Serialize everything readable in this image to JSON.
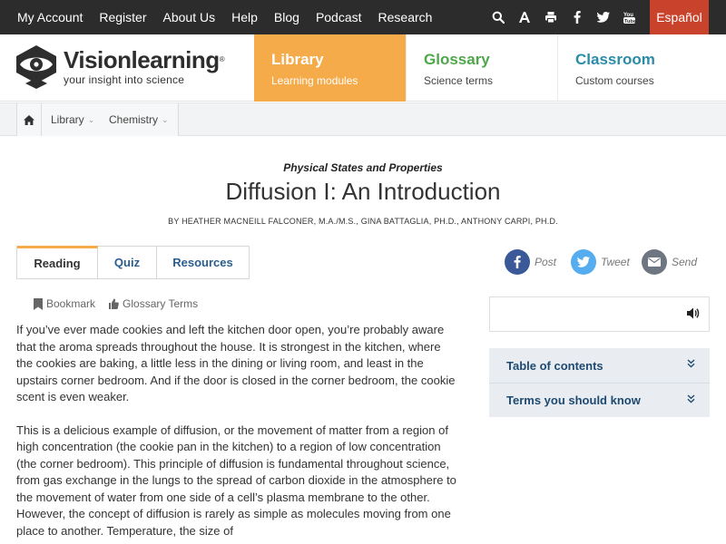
{
  "topnav": {
    "links": [
      "My Account",
      "Register",
      "About Us",
      "Help",
      "Blog",
      "Podcast",
      "Research"
    ],
    "icons": [
      "search-icon",
      "font-size-icon",
      "print-icon",
      "facebook-icon",
      "twitter-icon",
      "youtube-icon"
    ],
    "language": "Español"
  },
  "brand": {
    "name": "Visionlearning",
    "registered": "®",
    "tagline": "your insight into science"
  },
  "header_tabs": [
    {
      "title": "Library",
      "subtitle": "Learning modules",
      "color": "#f5ab4a"
    },
    {
      "title": "Glossary",
      "subtitle": "Science terms",
      "color": "#4fa64b"
    },
    {
      "title": "Classroom",
      "subtitle": "Custom courses",
      "color": "#2a8ca8"
    }
  ],
  "breadcrumb": {
    "home_icon": "home-icon",
    "items": [
      "Library",
      "Chemistry"
    ]
  },
  "article": {
    "kicker": "Physical States and Properties",
    "title": "Diffusion I: An Introduction",
    "authors": "BY HEATHER MACNEILL FALCONER, M.A./M.S., GINA BATTAGLIA, PH.D., ANTHONY CARPI, PH.D.",
    "tabs": [
      "Reading",
      "Quiz",
      "Resources"
    ],
    "tools": {
      "bookmark": "Bookmark",
      "glossary": "Glossary Terms"
    },
    "paragraphs": [
      "If you’ve ever made cookies and left the kitchen door open, you’re probably aware that the aroma spreads throughout the house. It is strongest in the kitchen, where the cookies are baking, a little less in the dining or living room, and least in the upstairs corner bedroom. And if the door is closed in the corner bedroom, the cookie scent is even weaker.",
      "This is a delicious example of diffusion, or the movement of matter from a region of high concentration (the cookie pan in the kitchen) to a region of low concentration (the corner bedroom). This principle of diffusion is fundamental throughout science, from gas exchange in the lungs to the spread of carbon dioxide in the atmosphere to the movement of water from one side of a cell’s plasma membrane to the other. However, the concept of diffusion is rarely as simple as molecules moving from one place to another. Temperature, the size of"
    ]
  },
  "share": {
    "post": "Post",
    "tweet": "Tweet",
    "send": "Send"
  },
  "sidebar": {
    "audio_icon": "speaker-icon",
    "sections": [
      "Table of contents",
      "Terms you should know"
    ]
  }
}
